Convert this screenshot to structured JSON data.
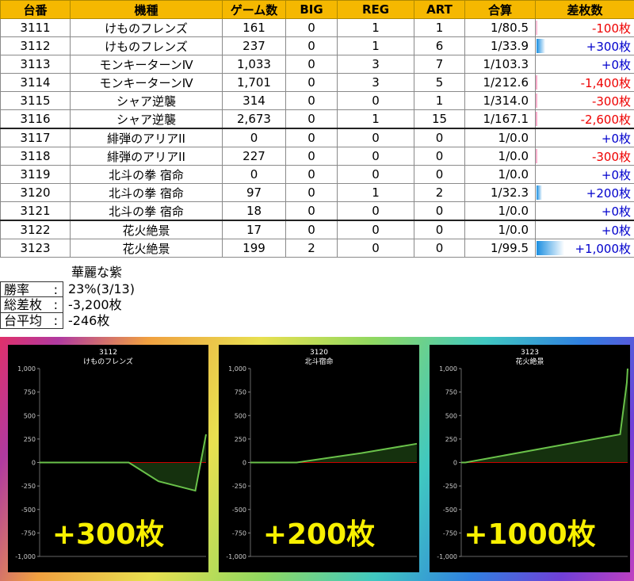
{
  "table": {
    "headers": [
      "台番",
      "機種",
      "ゲーム数",
      "BIG",
      "REG",
      "ART",
      "合算",
      "差枚数"
    ],
    "rows": [
      {
        "no": "3111",
        "model": "けものフレンズ",
        "games": "161",
        "big": "0",
        "reg": "1",
        "art": "1",
        "rate": "1/80.5",
        "diff": "-100枚",
        "diff_value": -100
      },
      {
        "no": "3112",
        "model": "けものフレンズ",
        "games": "237",
        "big": "0",
        "reg": "1",
        "art": "6",
        "rate": "1/33.9",
        "diff": "+300枚",
        "diff_value": 300
      },
      {
        "no": "3113",
        "model": "モンキーターンⅣ",
        "games": "1,033",
        "big": "0",
        "reg": "3",
        "art": "7",
        "rate": "1/103.3",
        "diff": "+0枚",
        "diff_value": 0
      },
      {
        "no": "3114",
        "model": "モンキーターンⅣ",
        "games": "1,701",
        "big": "0",
        "reg": "3",
        "art": "5",
        "rate": "1/212.6",
        "diff": "-1,400枚",
        "diff_value": -1400
      },
      {
        "no": "3115",
        "model": "シャア逆襲",
        "games": "314",
        "big": "0",
        "reg": "0",
        "art": "1",
        "rate": "1/314.0",
        "diff": "-300枚",
        "diff_value": -300
      },
      {
        "no": "3116",
        "model": "シャア逆襲",
        "games": "2,673",
        "big": "0",
        "reg": "1",
        "art": "15",
        "rate": "1/167.1",
        "diff": "-2,600枚",
        "diff_value": -2600
      },
      {
        "no": "3117",
        "model": "緋弾のアリアII",
        "games": "0",
        "big": "0",
        "reg": "0",
        "art": "0",
        "rate": "1/0.0",
        "diff": "+0枚",
        "diff_value": 0
      },
      {
        "no": "3118",
        "model": "緋弾のアリアII",
        "games": "227",
        "big": "0",
        "reg": "0",
        "art": "0",
        "rate": "1/0.0",
        "diff": "-300枚",
        "diff_value": -300
      },
      {
        "no": "3119",
        "model": "北斗の拳 宿命",
        "games": "0",
        "big": "0",
        "reg": "0",
        "art": "0",
        "rate": "1/0.0",
        "diff": "+0枚",
        "diff_value": 0
      },
      {
        "no": "3120",
        "model": "北斗の拳 宿命",
        "games": "97",
        "big": "0",
        "reg": "1",
        "art": "2",
        "rate": "1/32.3",
        "diff": "+200枚",
        "diff_value": 200
      },
      {
        "no": "3121",
        "model": "北斗の拳 宿命",
        "games": "18",
        "big": "0",
        "reg": "0",
        "art": "0",
        "rate": "1/0.0",
        "diff": "+0枚",
        "diff_value": 0
      },
      {
        "no": "3122",
        "model": "花火絶景",
        "games": "17",
        "big": "0",
        "reg": "0",
        "art": "0",
        "rate": "1/0.0",
        "diff": "+0枚",
        "diff_value": 0
      },
      {
        "no": "3123",
        "model": "花火絶景",
        "games": "199",
        "big": "2",
        "reg": "0",
        "art": "0",
        "rate": "1/99.5",
        "diff": "+1,000枚",
        "diff_value": 1000
      }
    ]
  },
  "summary": {
    "title": "華麗な紫",
    "win_rate_label": "勝率",
    "win_rate_value": "23%(3/13)",
    "total_label": "総差枚",
    "total_value": "-3,200枚",
    "avg_label": "台平均",
    "avg_value": "-246枚",
    "colon": ":"
  },
  "colors": {
    "header_bg": "#f5b800",
    "positive_text": "#0000cc",
    "negative_text": "#ee0000",
    "positive_bar": "#1a8ee0",
    "negative_bar": "#f7a8c8",
    "graph_line": "#6ac24a",
    "zero_line": "#cc0000",
    "big_text": "#f8f000"
  },
  "chart_data": [
    {
      "type": "area",
      "title": "3112",
      "subtitle": "けものフレンズ",
      "ylim": [
        -1000,
        1000
      ],
      "yticks": [
        "1,000",
        "750",
        "500",
        "250",
        "0",
        "-250",
        "-500",
        "-750",
        "-1,000"
      ],
      "x": [
        0,
        30,
        75,
        100,
        131,
        140
      ],
      "y": [
        0,
        0,
        0,
        -200,
        -300,
        300
      ],
      "badge": "+300枚"
    },
    {
      "type": "area",
      "title": "3120",
      "subtitle": "北斗宿命",
      "ylim": [
        -1000,
        1000
      ],
      "yticks": [
        "1,000",
        "750",
        "500",
        "250",
        "0",
        "-250",
        "-500",
        "-750",
        "-1,000"
      ],
      "x": [
        0,
        25,
        60,
        90
      ],
      "y": [
        0,
        0,
        100,
        200
      ],
      "badge": "+200枚"
    },
    {
      "type": "area",
      "title": "3123",
      "subtitle": "花火絶景",
      "ylim": [
        -1000,
        1000
      ],
      "yticks": [
        "1,000",
        "750",
        "500",
        "250",
        "0",
        "-250",
        "-500",
        "-750",
        "-1,000"
      ],
      "x": [
        0,
        5,
        190,
        198,
        199
      ],
      "y": [
        0,
        0,
        300,
        850,
        1000
      ],
      "badge": "+1000枚"
    }
  ]
}
